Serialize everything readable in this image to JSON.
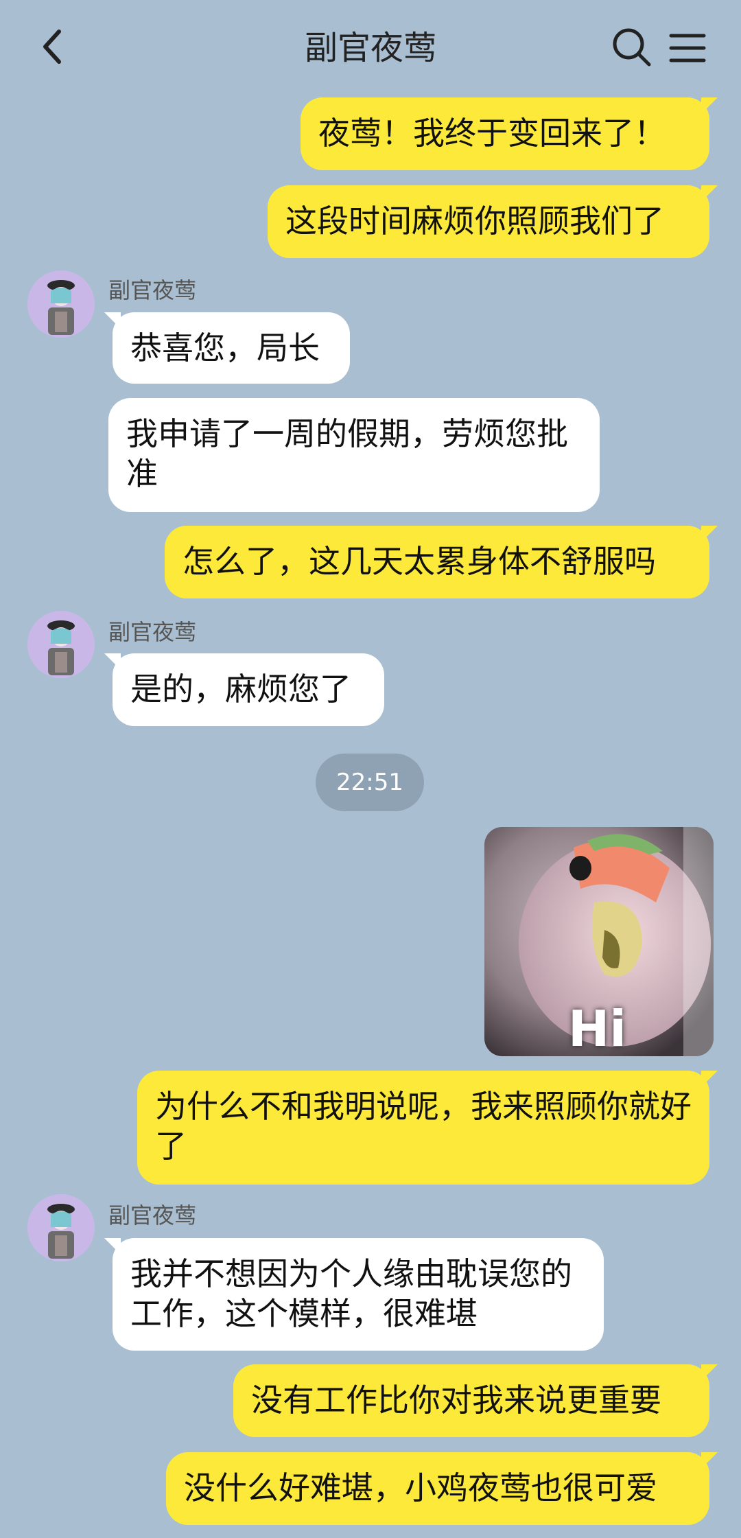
{
  "header": {
    "title": "副官夜莺",
    "back_icon": "chevron-left-icon",
    "search_icon": "search-icon",
    "menu_icon": "hamburger-menu-icon"
  },
  "messages": [
    {
      "side": "me",
      "text": "夜莺！我终于变回来了！"
    },
    {
      "side": "me",
      "text": "这段时间麻烦你照顾我们了"
    },
    {
      "side": "other",
      "sender": "副官夜莺",
      "text": "恭喜您，局长"
    },
    {
      "side": "other",
      "text": "我申请了一周的假期，劳烦您批准"
    },
    {
      "side": "me",
      "text": "怎么了，这几天太累身体不舒服吗"
    },
    {
      "side": "other",
      "sender": "副官夜莺",
      "text": "是的，麻烦您了"
    },
    {
      "type": "timestamp",
      "text": "22:51"
    },
    {
      "side": "me",
      "type": "image",
      "caption": "Hi"
    },
    {
      "side": "me",
      "text": "为什么不和我明说呢，我来照顾你就好了"
    },
    {
      "side": "other",
      "sender": "副官夜莺",
      "text": "我并不想因为个人缘由耽误您的工作，这个模样，很难堪"
    },
    {
      "side": "me",
      "text": "没有工作比你对我来说更重要"
    },
    {
      "side": "me",
      "text": "没什么好难堪，小鸡夜莺也很可爱"
    }
  ],
  "colors": {
    "background": "#a9bfd1",
    "me_bubble": "#fde93a",
    "other_bubble": "#ffffff",
    "timestamp_pill": "#8fa2b3"
  }
}
